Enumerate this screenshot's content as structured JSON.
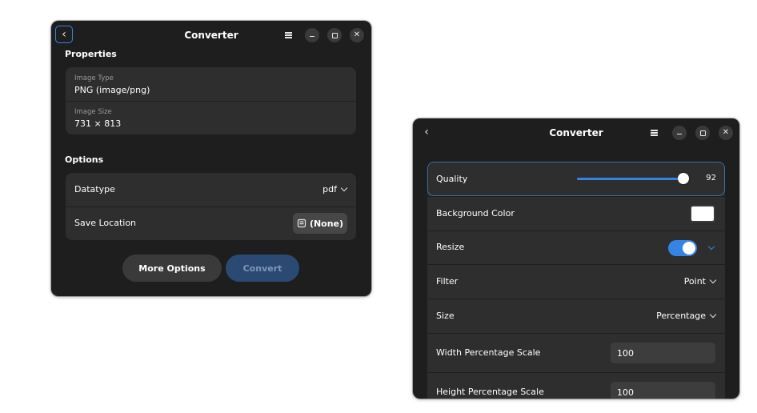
{
  "window1": {
    "title": "Converter",
    "back_icon": "‹",
    "properties": {
      "heading": "Properties",
      "image_type_caption": "Image Type",
      "image_type_value": "PNG (image/png)",
      "image_size_caption": "Image Size",
      "image_size_value": "731 × 813"
    },
    "options": {
      "heading": "Options",
      "datatype_label": "Datatype",
      "datatype_value": "pdf",
      "save_location_label": "Save Location",
      "save_location_value": "(None)"
    },
    "more_options_label": "More Options",
    "convert_label": "Convert"
  },
  "window2": {
    "title": "Converter",
    "back_icon": "‹",
    "quality_label": "Quality",
    "quality_value": "92",
    "background_color_label": "Background Color",
    "background_color_value": "#ffffff",
    "resize_label": "Resize",
    "resize_enabled": true,
    "filter_label": "Filter",
    "filter_value": "Point",
    "size_label": "Size",
    "size_value": "Percentage",
    "width_scale_label": "Width Percentage Scale",
    "width_scale_value": "100",
    "height_scale_label": "Height Percentage Scale",
    "height_scale_value": "100"
  },
  "colors": {
    "accent": "#3584e4",
    "window_bg": "#1e1e1e",
    "card_bg": "#2e2e2e",
    "convert_disabled_bg": "#2a4a73",
    "convert_disabled_text": "#7d97b8"
  }
}
